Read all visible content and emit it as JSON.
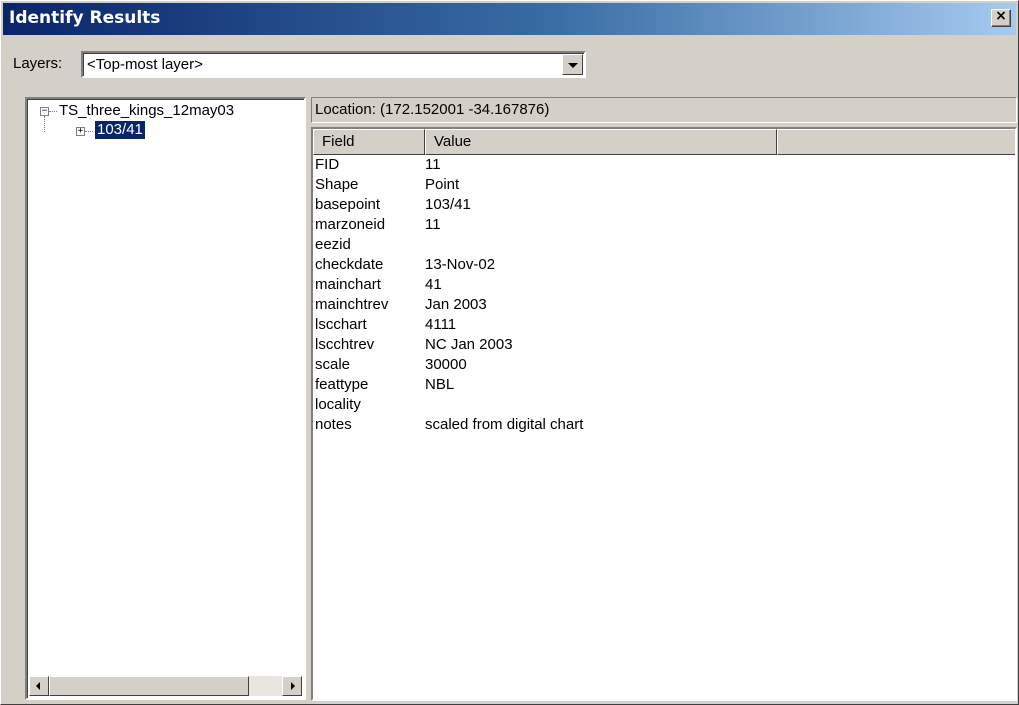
{
  "window": {
    "title": "Identify Results",
    "close_glyph": "×",
    "colors": {
      "titlebar_start": "#0a246a",
      "titlebar_end": "#a6caf0",
      "face": "#d4d0c8",
      "selection": "#0a246a"
    }
  },
  "layers": {
    "label": "Layers:",
    "value": "<Top-most layer>"
  },
  "tree": {
    "root": {
      "label": "TS_three_kings_12may03",
      "expander": "−"
    },
    "child": {
      "label": "103/41",
      "expander": "+"
    }
  },
  "location": {
    "text": "Location: (172.152001 -34.167876)"
  },
  "results": {
    "headers": {
      "field": "Field",
      "value": "Value"
    },
    "rows": [
      {
        "field": "FID",
        "value": "11"
      },
      {
        "field": "Shape",
        "value": "Point"
      },
      {
        "field": "basepoint",
        "value": "103/41"
      },
      {
        "field": "marzoneid",
        "value": "11"
      },
      {
        "field": "eezid",
        "value": ""
      },
      {
        "field": "checkdate",
        "value": "13-Nov-02"
      },
      {
        "field": "mainchart",
        "value": "41"
      },
      {
        "field": "mainchtrev",
        "value": "Jan 2003"
      },
      {
        "field": "lscchart",
        "value": "4111"
      },
      {
        "field": "lscchtrev",
        "value": "NC Jan 2003"
      },
      {
        "field": "scale",
        "value": "30000"
      },
      {
        "field": "feattype",
        "value": "NBL"
      },
      {
        "field": "locality",
        "value": ""
      },
      {
        "field": "notes",
        "value": "scaled from digital chart"
      }
    ]
  }
}
